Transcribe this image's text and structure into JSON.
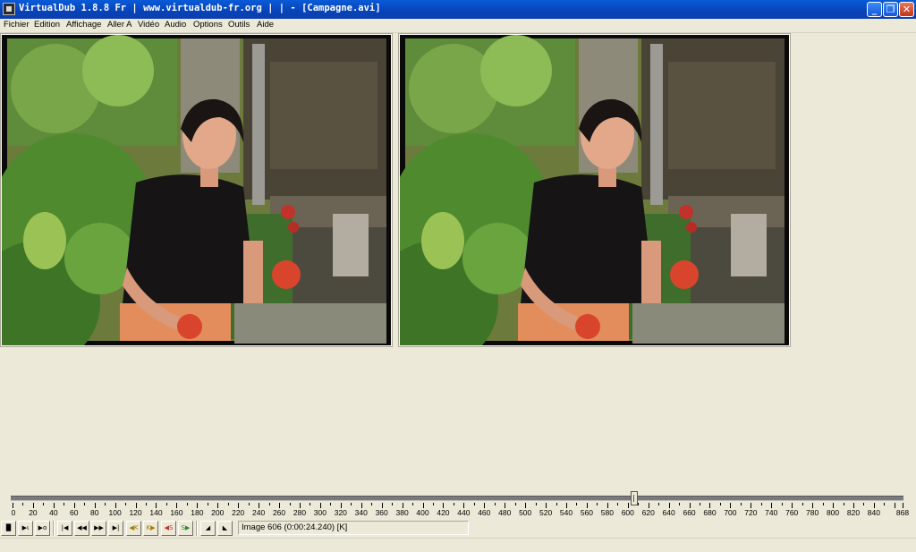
{
  "window": {
    "title": "VirtualDub 1.8.8 Fr | www.virtualdub-fr.org | |  - [Campagne.avi]",
    "buttons": [
      "minimize",
      "maximize",
      "close"
    ]
  },
  "menu": {
    "items": [
      "Fichier",
      "Edition",
      "Affichage",
      "Aller A",
      "Vidéo",
      "Audio",
      "Options",
      "Outils",
      "Aide"
    ]
  },
  "panes": {
    "input": {
      "icon": "video-frame-image"
    },
    "output": {
      "icon": "video-frame-image"
    }
  },
  "timeline": {
    "min": 0,
    "max": 868,
    "current_frame": 606,
    "tick_labels": [
      "0",
      "20",
      "40",
      "60",
      "80",
      "100",
      "120",
      "140",
      "160",
      "180",
      "200",
      "220",
      "240",
      "260",
      "280",
      "300",
      "320",
      "340",
      "360",
      "380",
      "400",
      "420",
      "440",
      "460",
      "480",
      "500",
      "520",
      "540",
      "560",
      "580",
      "600",
      "620",
      "640",
      "660",
      "680",
      "700",
      "720",
      "740",
      "760",
      "780",
      "800",
      "820",
      "840",
      "868"
    ]
  },
  "toolbar": {
    "buttons": [
      {
        "name": "stop-button",
        "icon": "stop-icon"
      },
      {
        "name": "play-input-button",
        "icon": "play-input-icon"
      },
      {
        "name": "play-output-button",
        "icon": "play-output-icon"
      },
      {
        "name": "go-start-button",
        "icon": "go-start-icon"
      },
      {
        "name": "prev-frame-button",
        "icon": "prev-frame-icon"
      },
      {
        "name": "next-frame-button",
        "icon": "next-frame-icon"
      },
      {
        "name": "go-end-button",
        "icon": "go-end-icon"
      },
      {
        "name": "prev-key-button",
        "icon": "prev-key-icon"
      },
      {
        "name": "next-key-button",
        "icon": "next-key-icon"
      },
      {
        "name": "prev-scene-button",
        "icon": "prev-scene-icon"
      },
      {
        "name": "next-scene-button",
        "icon": "next-scene-icon"
      },
      {
        "name": "mark-in-button",
        "icon": "mark-in-icon"
      },
      {
        "name": "mark-out-button",
        "icon": "mark-out-icon"
      }
    ],
    "status": "Image 606 (0:00:24.240) [K]"
  }
}
